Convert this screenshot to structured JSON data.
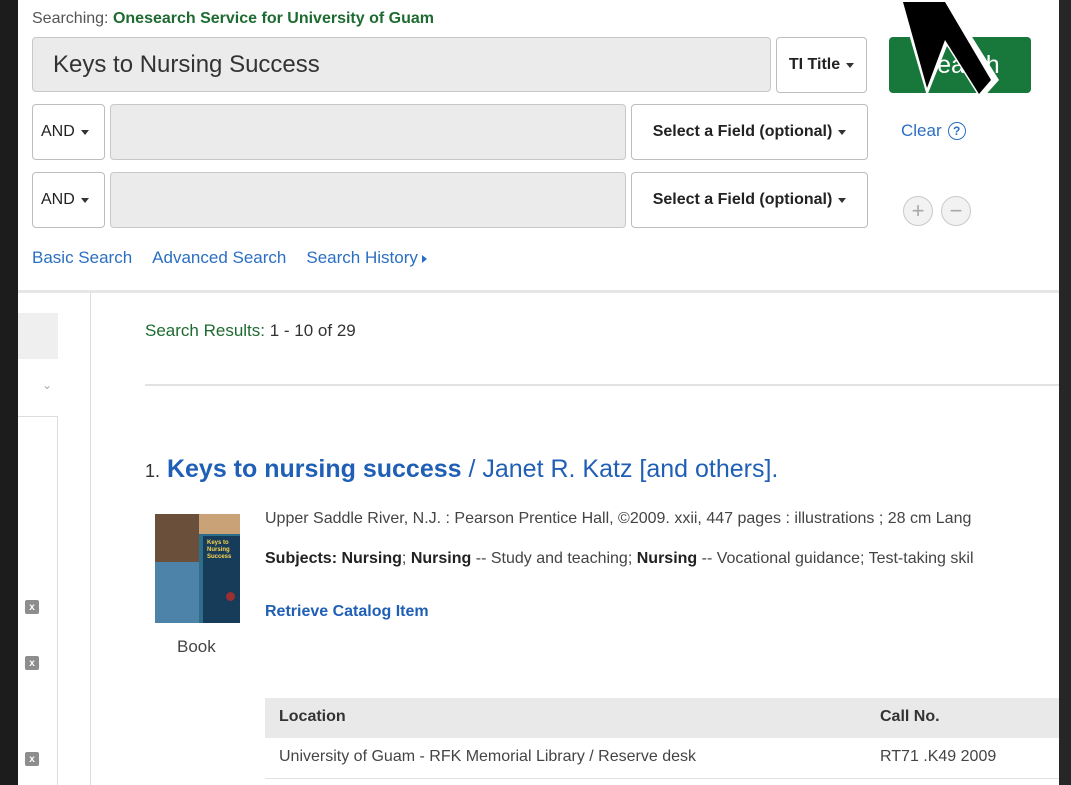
{
  "search": {
    "searching_prefix": "Searching:",
    "service": "Onesearch Service for University of Guam",
    "query": "Keys to Nursing Success",
    "field": "TI Title",
    "button": "Search",
    "rows": [
      {
        "operator": "AND",
        "field": "Select a Field (optional)"
      },
      {
        "operator": "AND",
        "field": "Select a Field (optional)"
      }
    ],
    "clear": "Clear",
    "help_glyph": "?",
    "add_glyph": "+",
    "remove_glyph": "−"
  },
  "nav_links": [
    "Basic Search",
    "Advanced Search",
    "Search History"
  ],
  "results": {
    "label": "Search Results:",
    "range": "1 - 10 of 29",
    "item": {
      "number": "1.",
      "title": "Keys to nursing success",
      "author": "/ Janet R. Katz [and others].",
      "publication": "Upper Saddle River, N.J. : Pearson Prentice Hall, ©2009. xxii, 447 pages : illustrations ; 28 cm Lang",
      "subjects_label": "Subjects:",
      "subjects": [
        {
          "term": "Nursing",
          "rest": ";"
        },
        {
          "term": "Nursing",
          "rest": "-- Study and teaching;"
        },
        {
          "term": "Nursing",
          "rest": "-- Vocational guidance; Test-taking skil"
        }
      ],
      "retrieve": "Retrieve Catalog Item",
      "format": "Book",
      "cover_text": "Keys to Nursing Success"
    },
    "table": {
      "headers": [
        "Location",
        "Call No."
      ],
      "rows": [
        [
          "University of Guam - RFK Memorial Library / Reserve desk",
          "RT71 .K49 2009"
        ]
      ]
    }
  },
  "left_panel": {
    "chevron": "⌄",
    "remove_glyph": "x"
  }
}
